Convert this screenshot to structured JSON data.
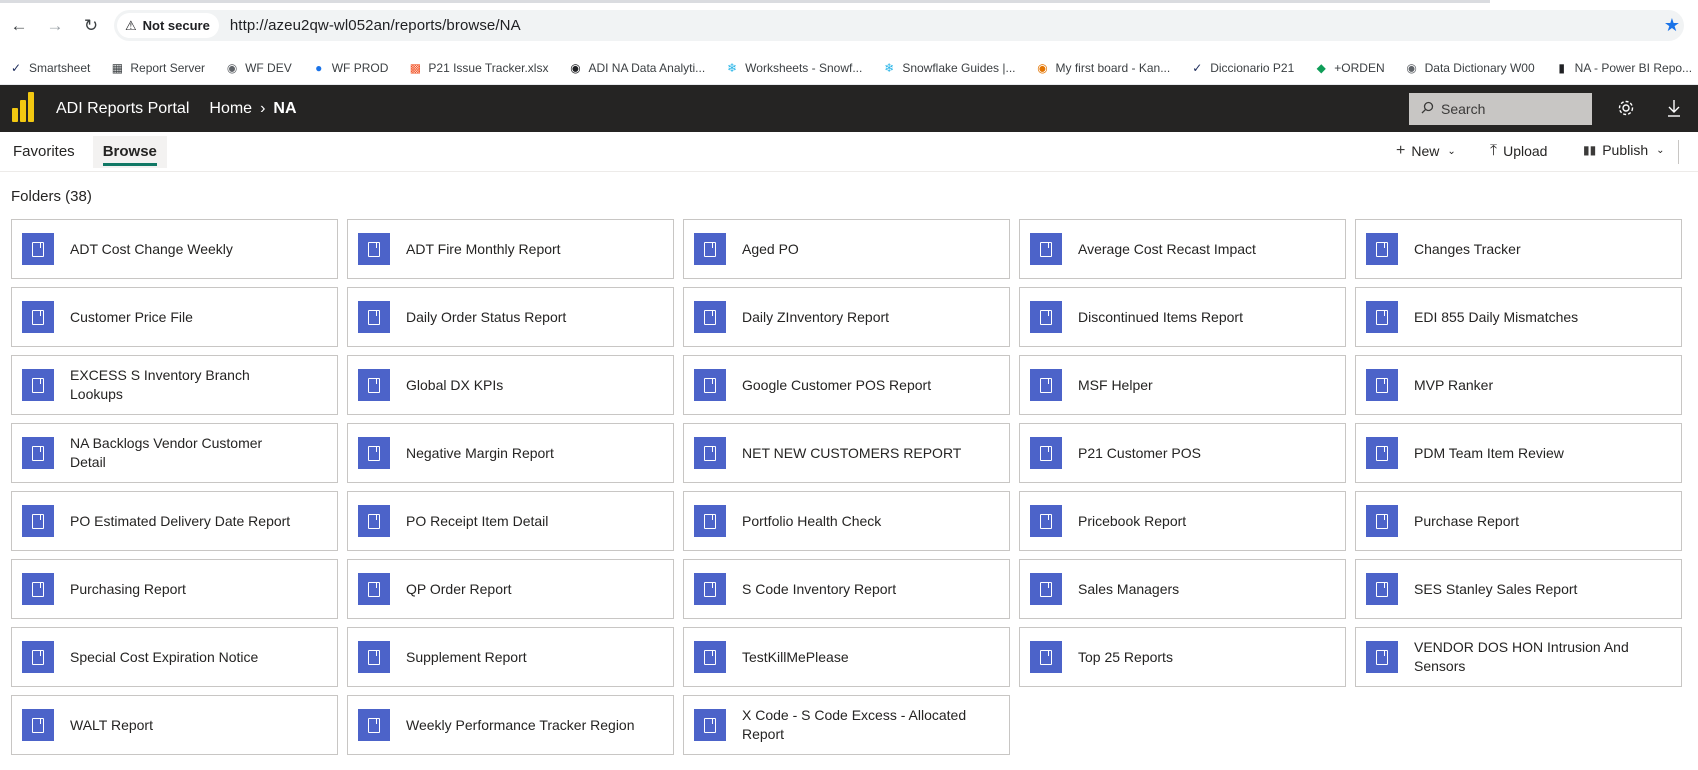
{
  "browser": {
    "security_label": "Not secure",
    "url": "http://azeu2qw-wl052an/reports/browse/NA"
  },
  "bookmarks": [
    {
      "label": "Smartsheet",
      "icon": "smartsheet-icon",
      "color": "#1b2a5a"
    },
    {
      "label": "Report Server",
      "icon": "report-server-icon",
      "color": "#3c4043"
    },
    {
      "label": "WF DEV",
      "icon": "globe-icon",
      "color": "#5f6368"
    },
    {
      "label": "WF PROD",
      "icon": "flame-icon",
      "color": "#1a73e8"
    },
    {
      "label": "P21 Issue Tracker.xlsx",
      "icon": "microsoft-icon",
      "color": "#f25022"
    },
    {
      "label": "ADI NA Data Analyti...",
      "icon": "github-icon",
      "color": "#202124"
    },
    {
      "label": "Worksheets - Snowf...",
      "icon": "snowflake-icon",
      "color": "#29b5e8"
    },
    {
      "label": "Snowflake Guides |...",
      "icon": "snowflake-icon",
      "color": "#29b5e8"
    },
    {
      "label": "My first board - Kan...",
      "icon": "kanban-icon",
      "color": "#e37400"
    },
    {
      "label": "Diccionario P21",
      "icon": "smartsheet-icon",
      "color": "#1b2a5a"
    },
    {
      "label": "+ORDEN",
      "icon": "orden-icon",
      "color": "#0f9d58"
    },
    {
      "label": "Data Dictionary W00",
      "icon": "globe-icon",
      "color": "#5f6368"
    },
    {
      "label": "NA - Power BI Repo...",
      "icon": "bar-chart-icon",
      "color": "#202124"
    }
  ],
  "portal": {
    "title": "ADI Reports Portal",
    "breadcrumb": [
      "Home",
      "NA"
    ],
    "search_placeholder": "Search",
    "brand_color": "#f2c811",
    "header_bg": "#252423"
  },
  "tabs": {
    "favorites": "Favorites",
    "browse": "Browse"
  },
  "actions": {
    "new": "New",
    "upload": "Upload",
    "publish": "Publish"
  },
  "folders_heading": "Folders (38)",
  "folder_icon_color": "#4c63c9",
  "folders": [
    "ADT Cost Change Weekly",
    "ADT Fire Monthly Report",
    "Aged PO",
    "Average Cost Recast Impact",
    "Changes Tracker",
    "Customer Price File",
    "Daily Order Status Report",
    "Daily ZInventory Report",
    "Discontinued Items Report",
    "EDI 855 Daily Mismatches",
    "EXCESS S Inventory Branch Lookups",
    "Global DX KPIs",
    "Google Customer POS Report",
    "MSF Helper",
    "MVP Ranker",
    "NA Backlogs Vendor Customer Detail",
    "Negative Margin Report",
    "NET NEW CUSTOMERS REPORT",
    "P21 Customer POS",
    "PDM Team Item Review",
    "PO Estimated Delivery Date Report",
    "PO Receipt Item Detail",
    "Portfolio Health Check",
    "Pricebook Report",
    "Purchase Report",
    "Purchasing Report",
    "QP Order Report",
    "S Code Inventory Report",
    "Sales Managers",
    "SES Stanley Sales Report",
    "Special Cost Expiration Notice",
    "Supplement Report",
    "TestKillMePlease",
    "Top 25 Reports",
    "VENDOR DOS HON Intrusion And Sensors",
    "WALT Report",
    "Weekly Performance Tracker Region",
    "X Code - S Code Excess - Allocated Report"
  ]
}
